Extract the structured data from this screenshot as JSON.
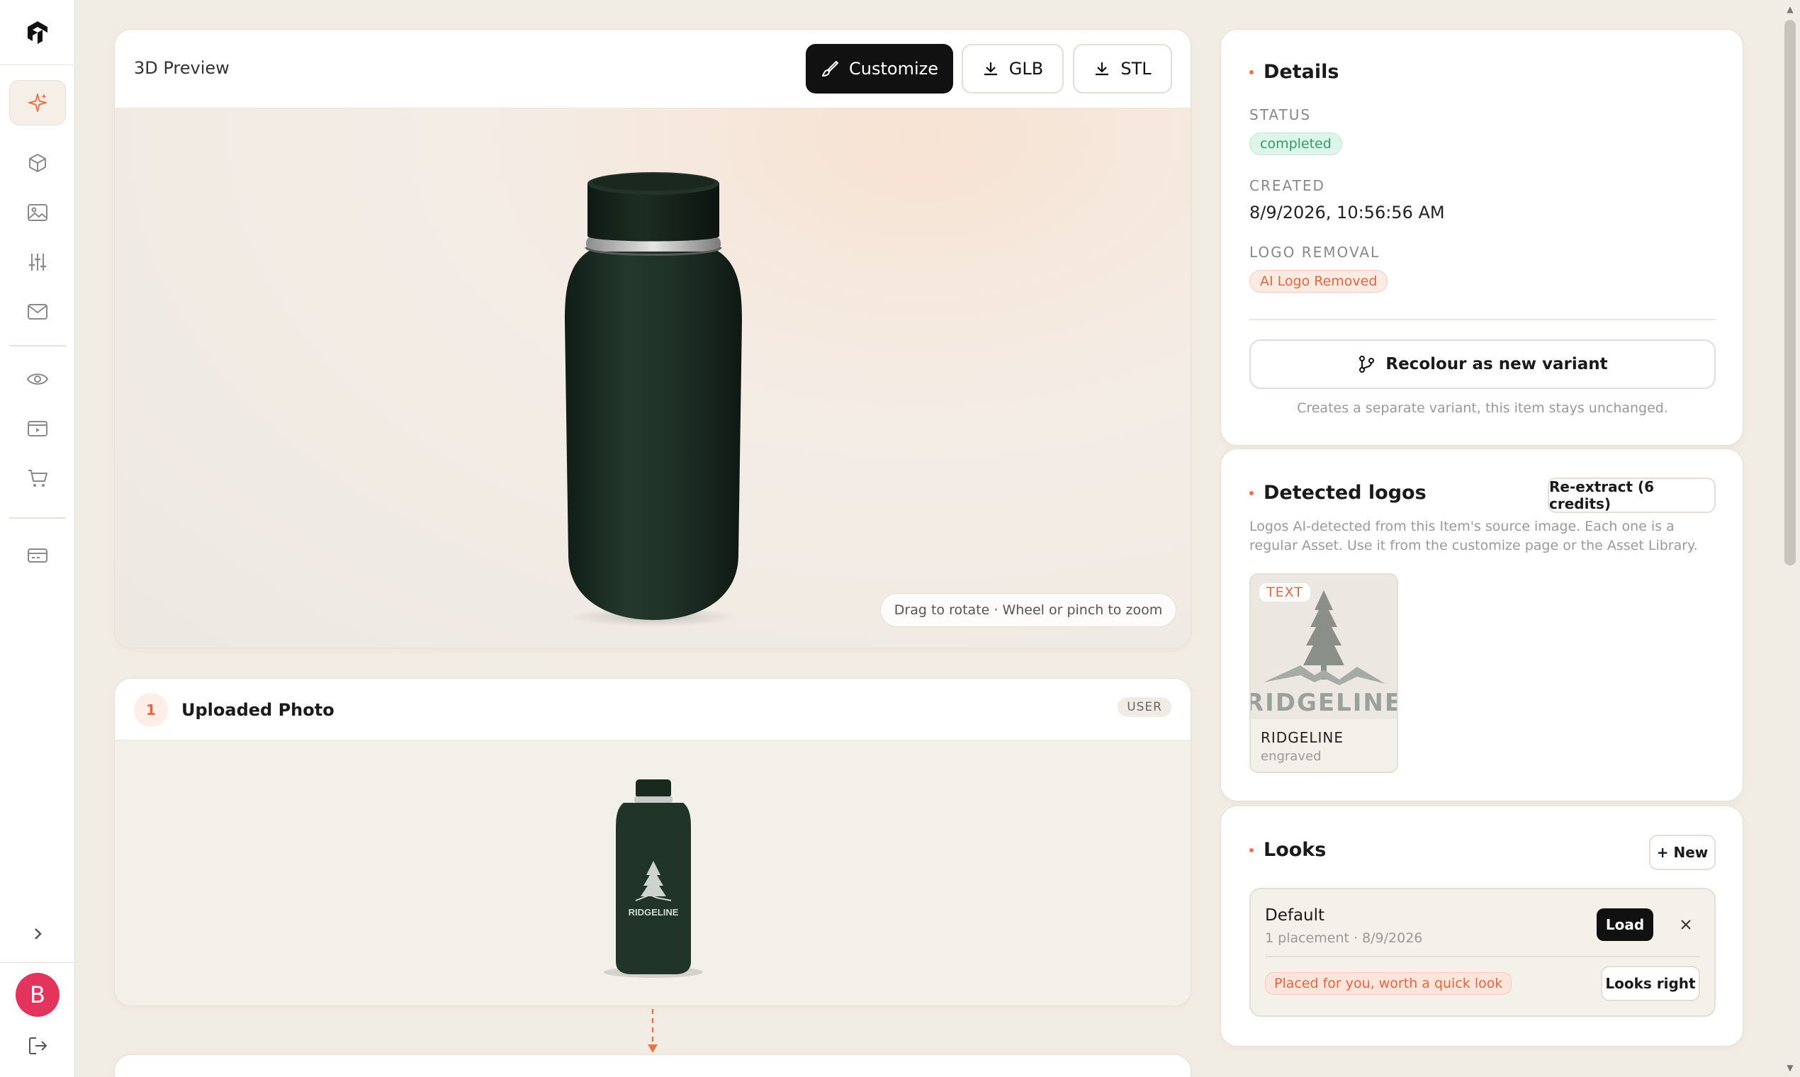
{
  "sidebar": {
    "items": [
      {
        "icon": "sparkle-icon",
        "active": true
      },
      {
        "icon": "cube-icon"
      },
      {
        "icon": "image-icon"
      },
      {
        "icon": "sliders-icon"
      },
      {
        "icon": "mail-icon"
      },
      {
        "icon": "eye-icon"
      },
      {
        "icon": "media-icon"
      },
      {
        "icon": "cart-icon"
      },
      {
        "icon": "billing-icon"
      }
    ],
    "avatar_initial": "B",
    "accent": "#e8764d",
    "avatar_color": "#e2345d"
  },
  "preview": {
    "title": "3D Preview",
    "customize_label": "Customize",
    "glb_label": "GLB",
    "stl_label": "STL",
    "hint": "Drag to rotate · Wheel or pinch to zoom"
  },
  "uploaded": {
    "step": "1",
    "title": "Uploaded Photo",
    "tag": "USER",
    "bottle_text": "RIDGELINE"
  },
  "details": {
    "title": "Details",
    "status_label": "STATUS",
    "status_value": "completed",
    "created_label": "CREATED",
    "created_value": "8/9/2026, 10:56:56 AM",
    "logo_removal_label": "LOGO REMOVAL",
    "logo_removal_value": "AI Logo Removed",
    "recolour_label": "Recolour as new variant",
    "recolour_helper": "Creates a separate variant, this item stays unchanged."
  },
  "logos": {
    "title": "Detected logos",
    "reextract_label": "Re-extract (6 credits)",
    "description": "Logos AI-detected from this Item's source image. Each one is a regular Asset. Use it from the customize page or the Asset Library.",
    "items": [
      {
        "tag": "TEXT",
        "wordmark": "RIDGELINE",
        "name": "RIDGELINE",
        "sub": "engraved"
      }
    ]
  },
  "looks": {
    "title": "Looks",
    "new_label": "+ New",
    "items": [
      {
        "name": "Default",
        "meta": "1 placement · 8/9/2026",
        "load_label": "Load",
        "placed_label": "Placed for you, worth a quick look",
        "confirm_label": "Looks right"
      }
    ]
  },
  "colors": {
    "bottle": "#1f3329",
    "status_green": "#2e9d6b",
    "accent_orange": "#e2673e"
  }
}
